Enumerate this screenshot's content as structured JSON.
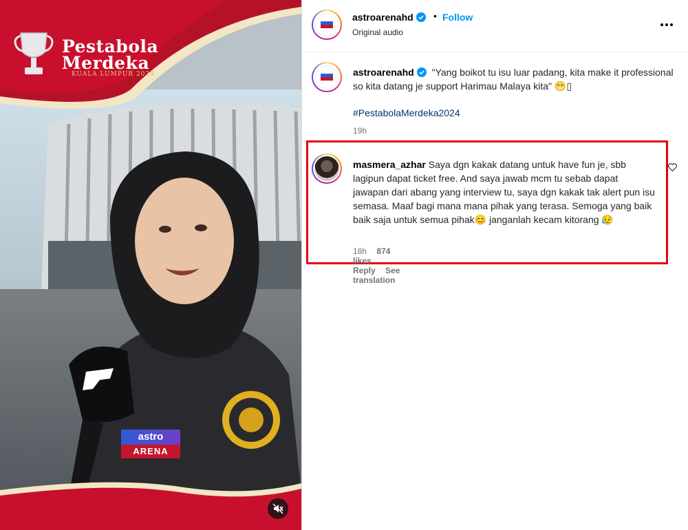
{
  "media": {
    "event_logo_line1": "Pestabola",
    "event_logo_line2": "Merdeka",
    "event_logo_sub": "KUALA LUMPUR 2024",
    "mic_brand_top": "astro",
    "mic_brand_bottom": "ARENA",
    "mute_icon": "speaker-muted-icon"
  },
  "header": {
    "username": "astroarenahd",
    "verified": true,
    "separator": "•",
    "follow_label": "Follow",
    "audio_label": "Original audio",
    "more_icon": "more-horizontal-icon"
  },
  "caption": {
    "username": "astroarenahd",
    "text": "\"Yang boikot tu isu luar padang, kita make it professional so kita datang je support Harimau Malaya kita\" 😁▯",
    "hashtag": "#PestabolaMerdeka2024",
    "time": "19h"
  },
  "comment": {
    "username": "masmera_azhar",
    "text": "Saya dgn kakak datang untuk have fun je, sbb lagipun dapat ticket free. And saya jawab mcm tu sebab dapat jawapan dari abang yang interview tu, saya dgn kakak tak alert pun isu semasa. Maaf bagi mana mana pihak yang terasa. Semoga yang baik baik saja untuk semua pihak😊 janganlah kecam kitorang 😥",
    "time": "18h",
    "likes": "874 likes",
    "reply_label": "Reply",
    "translate_label": "See translation",
    "highlight_color": "#e3000f"
  },
  "colors": {
    "link_blue": "#0095f6",
    "hashtag_blue": "#00376b",
    "muted_gray": "#737373",
    "banner_red": "#c8102e"
  }
}
